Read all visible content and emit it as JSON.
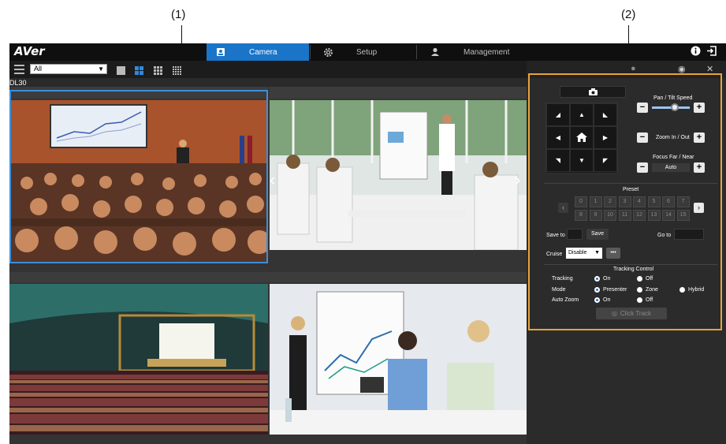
{
  "callouts": {
    "c1": "(1)",
    "c2": "(2)"
  },
  "app": {
    "logo": "AVer"
  },
  "tabs": [
    {
      "label": "Camera",
      "icon": "camera-icon",
      "active": true
    },
    {
      "label": "Setup",
      "icon": "gear-icon",
      "active": false
    },
    {
      "label": "Management",
      "icon": "user-icon",
      "active": false
    }
  ],
  "toolbar": {
    "group_value": "All",
    "device_label": "DL30"
  },
  "colors": {
    "accent": "#1a75c9",
    "selection": "#3a8fdc",
    "highlight_box": "#e8a33a"
  },
  "panel": {
    "pan_tilt_label": "Pan / Tilt Speed",
    "pan_tilt_speed": 0.6,
    "zoom_label": "Zoom In / Out",
    "focus_label": "Focus Far / Near",
    "focus_mode": "Auto",
    "preset_label": "Preset",
    "presets": [
      "0",
      "1",
      "2",
      "3",
      "4",
      "5",
      "6",
      "7",
      "8",
      "9",
      "10",
      "11",
      "12",
      "13",
      "14",
      "15"
    ],
    "save_to_label": "Save to",
    "save_button": "Save",
    "go_to_label": "Go to",
    "cruise_label": "Cruise",
    "cruise_value": "Disable",
    "more_button": "•••",
    "tracking_title": "Tracking Control",
    "tracking_label": "Tracking",
    "tracking_on": "On",
    "tracking_off": "Off",
    "mode_label": "Mode",
    "mode_presenter": "Presenter",
    "mode_zone": "Zone",
    "mode_hybrid": "Hybrid",
    "autozoom_label": "Auto Zoom",
    "autozoom_on": "On",
    "autozoom_off": "Off",
    "click_track": "Click Track"
  }
}
